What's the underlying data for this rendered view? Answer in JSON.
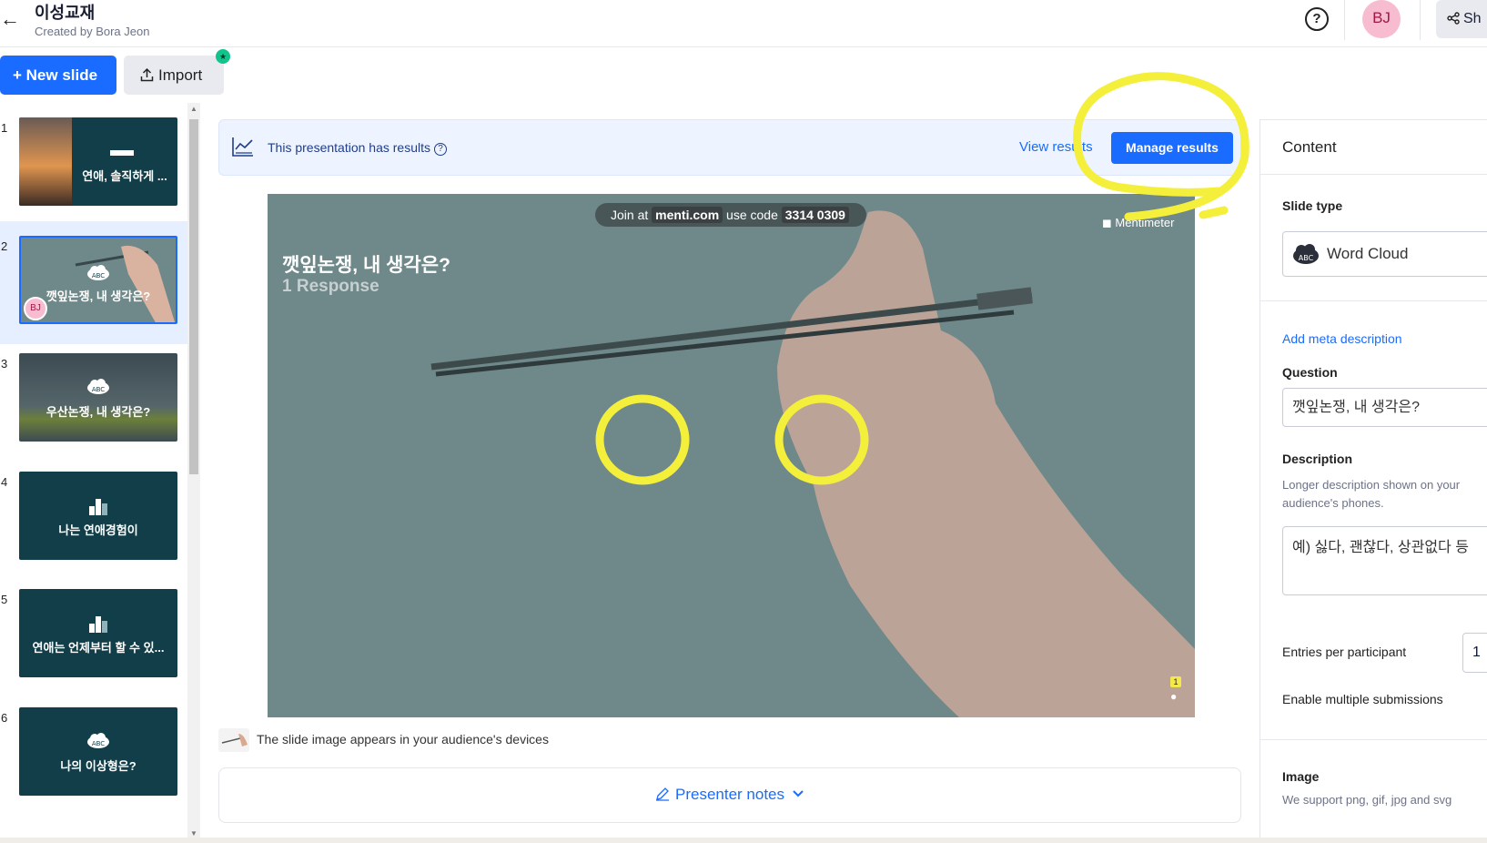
{
  "header": {
    "back_glyph": "←",
    "title": "이성교재",
    "creator": "Created by Bora Jeon",
    "help_glyph": "?",
    "avatar": "BJ",
    "share_label": "Sh"
  },
  "toolbar": {
    "new_slide": "+ New slide",
    "import": "Import"
  },
  "slides": [
    {
      "num": "1",
      "text": "연애, 솔직하게 ...",
      "icon": "text-icon"
    },
    {
      "num": "2",
      "text": "깻잎논쟁, 내 생각은?",
      "icon": "word-cloud-icon",
      "badge": "BJ"
    },
    {
      "num": "3",
      "text": "우산논쟁, 내 생각은?",
      "icon": "word-cloud-icon"
    },
    {
      "num": "4",
      "text": "나는 연애경험이",
      "icon": "bar-chart-icon"
    },
    {
      "num": "5",
      "text": "연애는 언제부터 할 수 있...",
      "icon": "bar-chart-icon"
    },
    {
      "num": "6",
      "text": "나의 이상형은?",
      "icon": "word-cloud-icon"
    }
  ],
  "banner": {
    "text": "This presentation has results",
    "help_glyph": "?",
    "view_results": "View results",
    "manage_results": "Manage results"
  },
  "canvas": {
    "join_prefix": "Join at",
    "join_url": "menti.com",
    "code_prefix": "use code",
    "code": "3314 0309",
    "brand": "Mentimeter",
    "title": "깻잎논쟁, 내 생각은?",
    "responses": "1 Response",
    "response_count": "1"
  },
  "slide_image_note": "The slide image appears in your audience's devices",
  "presenter_notes": "Presenter notes",
  "right_panel": {
    "content": "Content",
    "slide_type_label": "Slide type",
    "slide_type_value": "Word Cloud",
    "add_meta": "Add meta description",
    "question_label": "Question",
    "question_value": "깻잎논쟁, 내 생각은?",
    "description_label": "Description",
    "description_hint": "Longer description shown on your audience's phones.",
    "description_value": "예) 싫다, 괜찮다, 상관없다 등",
    "entries_label": "Entries per participant",
    "entries_value": "1",
    "multi_label": "Enable multiple submissions",
    "image_label": "Image",
    "image_hint": "We support png, gif, jpg and svg"
  },
  "colors": {
    "accent": "#196cff",
    "slide_bg": "#6f888a",
    "thumb_bg": "#113e48",
    "annotation": "#f4ef3a"
  }
}
